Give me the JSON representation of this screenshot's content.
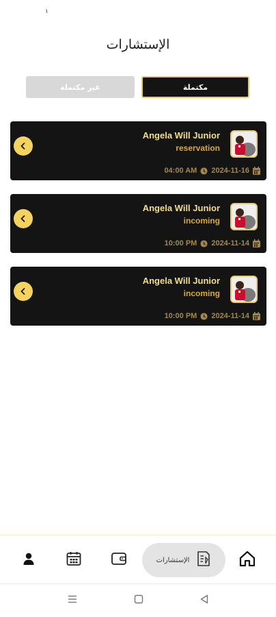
{
  "status": {
    "mark": "۱"
  },
  "header": {
    "title": "الإستشارات"
  },
  "tabs": {
    "completed": "مكتملة",
    "incomplete": "غير مكتملة"
  },
  "consultations": [
    {
      "name": "Angela Will Junior",
      "type": "reservation",
      "date": "2024-11-16",
      "time": "04:00 AM"
    },
    {
      "name": "Angela Will Junior",
      "type": "incoming",
      "date": "2024-11-14",
      "time": "10:00 PM"
    },
    {
      "name": "Angela Will Junior",
      "type": "incoming",
      "date": "2024-11-14",
      "time": "10:00 PM"
    }
  ],
  "bottom_nav": {
    "active_label": "الإستشارات"
  },
  "colors": {
    "card_bg": "#141414",
    "gold": "#e8c96a",
    "accent_yellow": "#f4d35e",
    "name": "#f3dd8a",
    "type": "#d8a93a"
  }
}
